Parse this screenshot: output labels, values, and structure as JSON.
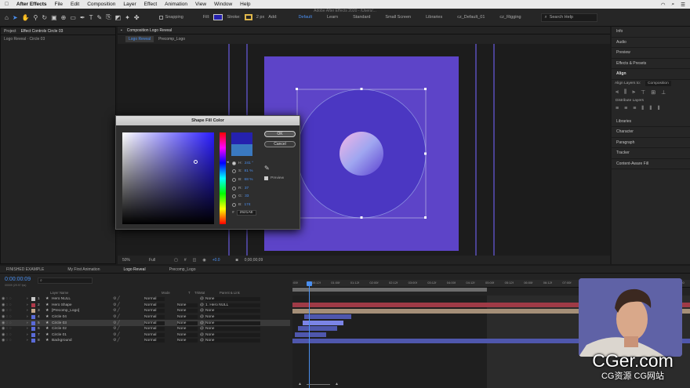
{
  "menubar": {
    "app_name": "After Effects",
    "items": [
      "File",
      "Edit",
      "Composition",
      "Layer",
      "Effect",
      "Animation",
      "View",
      "Window",
      "Help"
    ],
    "right_items": [
      "Search Help"
    ]
  },
  "window_title": "Adobe After Effects 2020 - /Users/...",
  "toolbar": {
    "snapping": "Snapping",
    "fill_label": "Fill:",
    "stroke_label": "Stroke:",
    "stroke_width": "2 px",
    "add_label": "Add:",
    "workspaces": [
      "Default",
      "Learn",
      "Standard",
      "Small Screen",
      "Libraries",
      "cz_Default_01",
      "cz_Rigging"
    ]
  },
  "left_panel": {
    "tabs": [
      "Project",
      "Effect Controls Circle 03"
    ],
    "subtitle": "Logo Reveal · Circle 03"
  },
  "comp_panel": {
    "title": "Composition Logo Reveal",
    "subtabs": [
      "Logo Reveal",
      "Precomp_Logo"
    ],
    "zoom": "50%",
    "resolution": "Full",
    "timecode": "0;00;00;09",
    "exposure": "+0.0"
  },
  "right_panel": {
    "items": [
      "Info",
      "Audio",
      "Preview",
      "Effects & Presets",
      "Align",
      "Align Layers to:",
      "Distribute Layers",
      "Libraries",
      "Character",
      "Paragraph",
      "Tracker",
      "Content-Aware Fill"
    ],
    "align_to": "Composition"
  },
  "dialog": {
    "title": "Shape Fill Color",
    "ok": "OK",
    "cancel": "Cancel",
    "preview": "Preview",
    "fields": [
      {
        "label": "H:",
        "value": "241 °"
      },
      {
        "label": "S:",
        "value": "81 %"
      },
      {
        "label": "B:",
        "value": "68 %"
      },
      {
        "label": "R:",
        "value": "37"
      },
      {
        "label": "G:",
        "value": "33"
      },
      {
        "label": "B:",
        "value": "174"
      }
    ],
    "hex": "2521AE",
    "new_color": "#2521ae",
    "old_color": "#3a79c0"
  },
  "timeline": {
    "tabs": [
      "FINISHED EXAMPLE",
      "My First Animation",
      "Logo Reveal",
      "Precomp_Logo"
    ],
    "timecode": "0:00:00:09",
    "fps": "00009 (29.97 fps)",
    "columns": [
      "Layer Name",
      "Mode",
      "T",
      "TrkMat",
      "Parent & Link"
    ],
    "ruler": [
      ":00f",
      "00:12f",
      "01:00f",
      "01:12f",
      "02:00f",
      "02:12f",
      "03:00f",
      "03:12f",
      "04:00f",
      "04:12f",
      "05:00f",
      "05:12f",
      "06:00f",
      "06:12f",
      "07:00f",
      "07:12f",
      "08:00f",
      "08:12f",
      "09:00f",
      "09:12f",
      "10:0"
    ],
    "layers": [
      {
        "num": "1",
        "name": "Hero NULL",
        "mode": "Normal",
        "trkmat": "",
        "parent": "None",
        "color": "#c7c7c7"
      },
      {
        "num": "2",
        "name": "Hero Shape",
        "mode": "Normal",
        "trkmat": "None",
        "parent": "1. Hero NULL",
        "color": "#b03a4a"
      },
      {
        "num": "3",
        "name": "[Precomp_Logo]",
        "mode": "Normal",
        "trkmat": "None",
        "parent": "None",
        "color": "#c4a88a"
      },
      {
        "num": "4",
        "name": "Circle 04",
        "mode": "Normal",
        "trkmat": "None",
        "parent": "None",
        "color": "#5a6bd8"
      },
      {
        "num": "5",
        "name": "Circle 03",
        "mode": "Normal",
        "trkmat": "None",
        "parent": "None",
        "color": "#5a6bd8"
      },
      {
        "num": "6",
        "name": "Circle 02",
        "mode": "Normal",
        "trkmat": "None",
        "parent": "None",
        "color": "#5a6bd8"
      },
      {
        "num": "7",
        "name": "Circle 01",
        "mode": "Normal",
        "trkmat": "None",
        "parent": "None",
        "color": "#5a6bd8"
      },
      {
        "num": "8",
        "name": "Background",
        "mode": "Normal",
        "trkmat": "None",
        "parent": "None",
        "color": "#5a6bd8"
      }
    ]
  },
  "watermark": {
    "main": "CGer.com",
    "sub": "CG资源 CG网站"
  }
}
